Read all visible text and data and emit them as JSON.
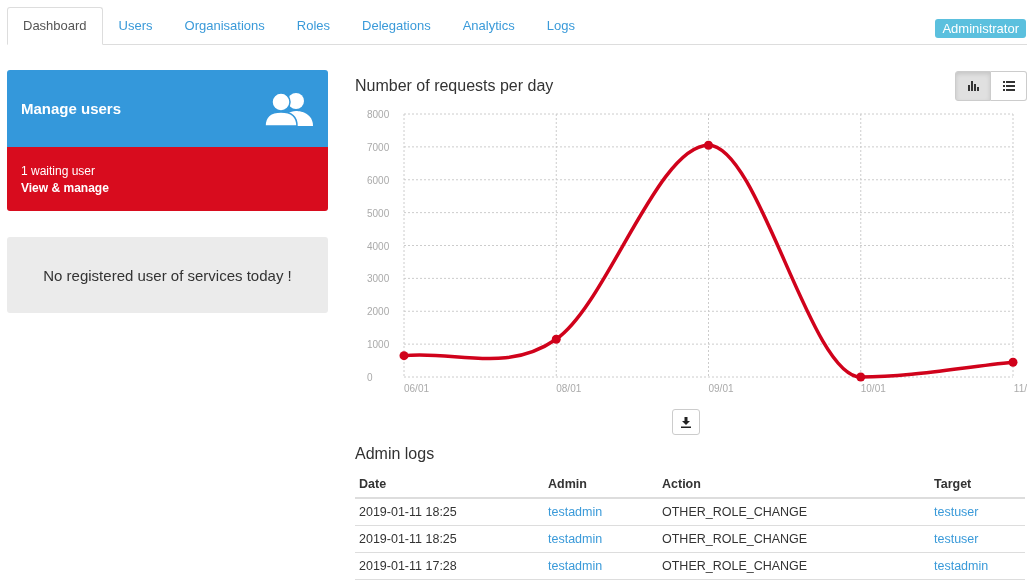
{
  "tabs": [
    {
      "label": "Dashboard",
      "selected": true
    },
    {
      "label": "Users",
      "selected": false
    },
    {
      "label": "Organisations",
      "selected": false
    },
    {
      "label": "Roles",
      "selected": false
    },
    {
      "label": "Delegations",
      "selected": false
    },
    {
      "label": "Analytics",
      "selected": false
    },
    {
      "label": "Logs",
      "selected": false
    }
  ],
  "role_badge": "Administrator",
  "manage_card": {
    "title": "Manage users",
    "waiting": "1 waiting user",
    "link": "View & manage"
  },
  "notice": "No registered user of services today !",
  "chart_panel": {
    "title": "Number of requests per day",
    "views": [
      {
        "kind": "chart",
        "selected": true
      },
      {
        "kind": "list",
        "selected": false
      }
    ],
    "chart_data": {
      "type": "line",
      "categories": [
        "06/01",
        "08/01",
        "09/01",
        "10/01",
        "11/"
      ],
      "ylim": [
        0,
        8000
      ],
      "yticks": [
        0,
        1000,
        2000,
        3000,
        4000,
        5000,
        6000,
        7000,
        8000
      ],
      "grid": true,
      "series": [
        {
          "color": "#d0021b",
          "marker": true,
          "values": [
            650,
            1150,
            7050,
            0,
            450
          ]
        }
      ]
    }
  },
  "logs": {
    "title": "Admin logs",
    "columns": [
      "Date",
      "Admin",
      "Action",
      "Target"
    ],
    "rows": [
      [
        "2019-01-11 18:25",
        "testadmin",
        "OTHER_ROLE_CHANGE",
        "testuser"
      ],
      [
        "2019-01-11 18:25",
        "testadmin",
        "OTHER_ROLE_CHANGE",
        "testuser"
      ],
      [
        "2019-01-11 17:28",
        "testadmin",
        "OTHER_ROLE_CHANGE",
        "testadmin"
      ]
    ]
  }
}
